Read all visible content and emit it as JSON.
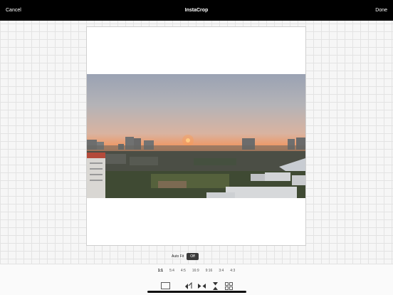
{
  "header": {
    "cancel_label": "Cancel",
    "title": "InstaCrop",
    "done_label": "Done"
  },
  "autofit": {
    "label": "Auto Fit",
    "value": "Off"
  },
  "ratios": [
    "1:1",
    "5:4",
    "4:5",
    "16:9",
    "9:16",
    "3:4",
    "4:3"
  ],
  "selected_ratio": "1:1",
  "toolbar_icons": [
    "frame-icon",
    "rotate-icon",
    "flip-horizontal-icon",
    "flip-vertical-icon",
    "grid-icon"
  ],
  "colors": {
    "topbar": "#000000",
    "toggle": "#3a3a3a",
    "battery": "#2ecc40"
  }
}
